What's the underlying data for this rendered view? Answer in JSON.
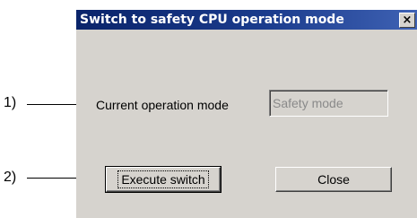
{
  "callouts": [
    "1)",
    "2)"
  ],
  "dialog": {
    "title": "Switch to safety CPU operation mode",
    "close_glyph": "×",
    "current_mode_label": "Current operation mode",
    "current_mode_value": "Safety mode",
    "execute_label": "Execute switch",
    "close_label": "Close"
  }
}
